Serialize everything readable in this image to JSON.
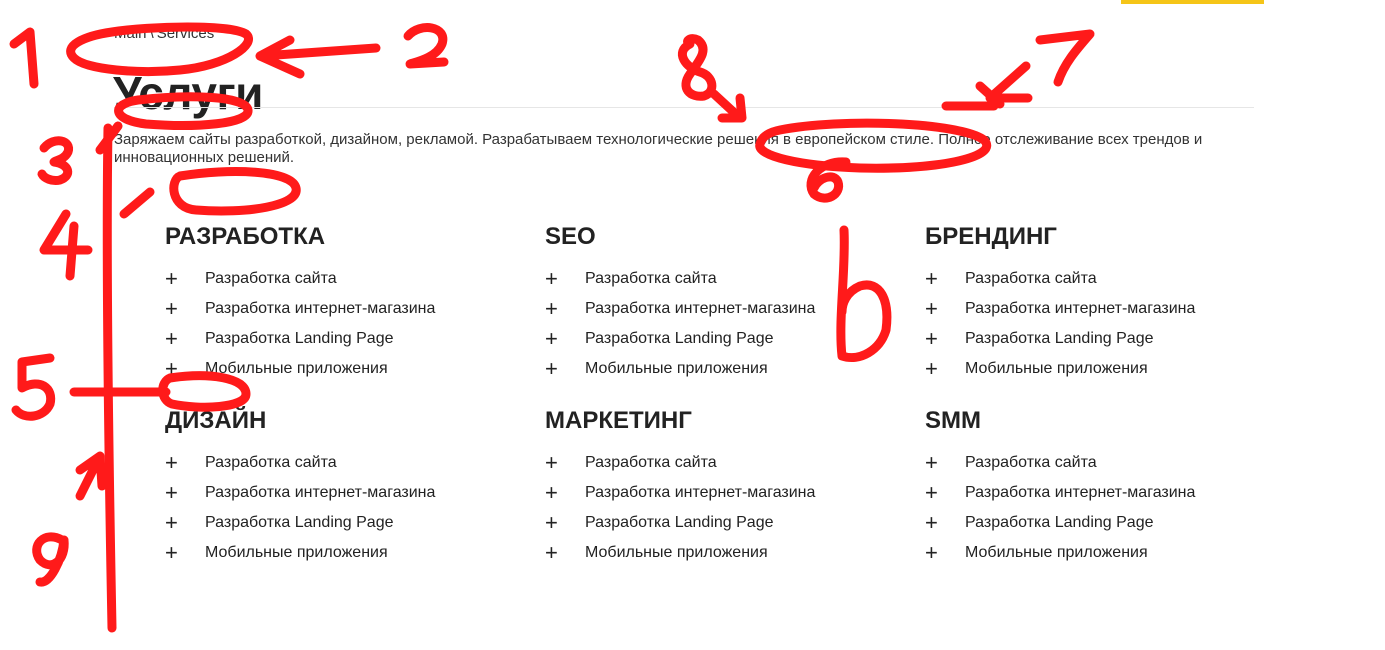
{
  "colors": {
    "accent": "#f5c518",
    "annotation": "#ff1a1a"
  },
  "breadcrumb": {
    "home": "Main",
    "separator": "\\",
    "current": "Services"
  },
  "page_title": "Услуги",
  "description": "Заряжаем сайты разработкой, дизайном, рекламой. Разрабатываем технологические решения в европейском стиле. Полное отслеживание всех трендов и инновационных решений.",
  "sections": [
    {
      "title": "РАЗРАБОТКА",
      "items": [
        "Разработка сайта",
        "Разработка интернет-магазина",
        "Разработка Landing Page",
        "Мобильные приложения"
      ]
    },
    {
      "title": "SEO",
      "items": [
        "Разработка сайта",
        "Разработка интернет-магазина",
        "Разработка Landing Page",
        "Мобильные приложения"
      ]
    },
    {
      "title": "БРЕНДИНГ",
      "items": [
        "Разработка сайта",
        "Разработка интернет-магазина",
        "Разработка Landing Page",
        "Мобильные приложения"
      ]
    },
    {
      "title": "ДИЗАЙН",
      "items": [
        "Разработка сайта",
        "Разработка интернет-магазина",
        "Разработка Landing Page",
        "Мобильные приложения"
      ]
    },
    {
      "title": "МАРКЕТИНГ",
      "items": [
        "Разработка сайта",
        "Разработка интернет-магазина",
        "Разработка Landing Page",
        "Мобильные приложения"
      ]
    },
    {
      "title": "SMM",
      "items": [
        "Разработка сайта",
        "Разработка интернет-магазина",
        "Разработка Landing Page",
        "Мобильные приложения"
      ]
    }
  ],
  "item_icon": "plus-icon",
  "annotation_numbers": [
    "1",
    "2",
    "3",
    "4",
    "5",
    "6",
    "7",
    "8",
    "9"
  ]
}
